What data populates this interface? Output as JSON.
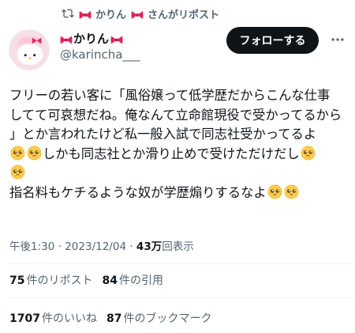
{
  "repost": {
    "user": "かりん",
    "suffix": "さんがリポスト"
  },
  "author": {
    "name": "かりん",
    "handle": "@karincha___"
  },
  "follow_label": "フォローする",
  "tweet": {
    "lines": [
      "フリーの若い客に「風俗嬢って低学歴だからこんな仕事",
      "してて可哀想だね。俺なんて立命館現役で受かってるから",
      "」とか言われたけど私一般入試で同志社受かってるよ",
      "しかも同志社とか滑り止めで受けただけだし",
      "",
      "指名料もケチるような奴が学歴煽りするなよ"
    ]
  },
  "meta": {
    "time": "午後1:30",
    "sep": "·",
    "date": "2023/12/04",
    "views": "43万",
    "views_label": "回表示"
  },
  "stats": {
    "reposts": "75",
    "reposts_label": "件のリポスト",
    "quotes": "84",
    "quotes_label": "件の引用",
    "likes": "1707",
    "likes_label": "件のいいね",
    "bookmarks": "87",
    "bookmarks_label": "件のブックマーク"
  },
  "colors": {
    "accent": "#0f1419",
    "secondary": "#536471",
    "bow": "#e0245e"
  },
  "icons": [
    "repost-icon",
    "bow-icon",
    "more-icon",
    "pleading-face-icon"
  ]
}
